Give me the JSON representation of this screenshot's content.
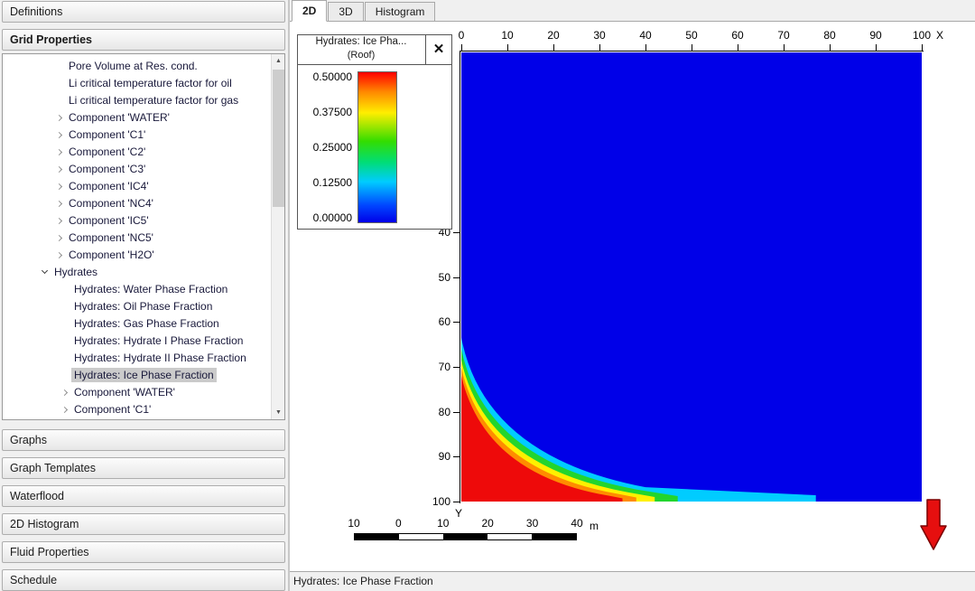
{
  "window": {
    "status_bar": "Hydrates: Ice Phase Fraction"
  },
  "sidebar": {
    "top_sections": [
      {
        "label": "Definitions",
        "bold": false
      },
      {
        "label": "Grid Properties",
        "bold": true
      }
    ],
    "tree_items": [
      {
        "label": "Pore Volume at Res. cond.",
        "level": 1,
        "arrow": "none",
        "selected": false
      },
      {
        "label": "Li critical temperature factor for oil",
        "level": 1,
        "arrow": "none",
        "selected": false
      },
      {
        "label": "Li critical temperature factor for gas",
        "level": 1,
        "arrow": "none",
        "selected": false
      },
      {
        "label": "Component 'WATER'",
        "level": 1,
        "arrow": "right",
        "selected": false
      },
      {
        "label": "Component 'C1'",
        "level": 1,
        "arrow": "right",
        "selected": false
      },
      {
        "label": "Component 'C2'",
        "level": 1,
        "arrow": "right",
        "selected": false
      },
      {
        "label": "Component 'C3'",
        "level": 1,
        "arrow": "right",
        "selected": false
      },
      {
        "label": "Component 'IC4'",
        "level": 1,
        "arrow": "right",
        "selected": false
      },
      {
        "label": "Component 'NC4'",
        "level": 1,
        "arrow": "right",
        "selected": false
      },
      {
        "label": "Component 'IC5'",
        "level": 1,
        "arrow": "right",
        "selected": false
      },
      {
        "label": "Component 'NC5'",
        "level": 1,
        "arrow": "right",
        "selected": false
      },
      {
        "label": "Component 'H2O'",
        "level": 1,
        "arrow": "right",
        "selected": false
      },
      {
        "label": "Hydrates",
        "level": 0,
        "arrow": "down",
        "selected": false
      },
      {
        "label": "Hydrates: Water Phase Fraction",
        "level": 2,
        "arrow": "none",
        "selected": false
      },
      {
        "label": "Hydrates: Oil Phase Fraction",
        "level": 2,
        "arrow": "none",
        "selected": false
      },
      {
        "label": "Hydrates: Gas Phase Fraction",
        "level": 2,
        "arrow": "none",
        "selected": false
      },
      {
        "label": "Hydrates: Hydrate I Phase Fraction",
        "level": 2,
        "arrow": "none",
        "selected": false
      },
      {
        "label": "Hydrates: Hydrate II Phase Fraction",
        "level": 2,
        "arrow": "none",
        "selected": false
      },
      {
        "label": "Hydrates: Ice Phase Fraction",
        "level": 2,
        "arrow": "none",
        "selected": true
      },
      {
        "label": "Component 'WATER'",
        "level": 2,
        "arrow": "right",
        "selected": false
      },
      {
        "label": "Component 'C1'",
        "level": 2,
        "arrow": "right",
        "selected": false
      }
    ],
    "bottom_sections": [
      {
        "label": "Graphs"
      },
      {
        "label": "Graph Templates"
      },
      {
        "label": "Waterflood"
      },
      {
        "label": "2D Histogram"
      },
      {
        "label": "Fluid Properties"
      },
      {
        "label": "Schedule"
      }
    ]
  },
  "tabs": [
    {
      "label": "2D",
      "active": true
    },
    {
      "label": "3D",
      "active": false
    },
    {
      "label": "Histogram",
      "active": false
    }
  ],
  "legend": {
    "title": "Hydrates: Ice Pha...",
    "subtitle": "(Roof)",
    "close_icon": "✕",
    "tick_labels": [
      "0.50000",
      "0.37500",
      "0.25000",
      "0.12500",
      "0.00000"
    ],
    "gradient_stops": [
      {
        "color": "#ff0000",
        "pos": 0
      },
      {
        "color": "#ff8800",
        "pos": 13
      },
      {
        "color": "#ffee00",
        "pos": 27
      },
      {
        "color": "#33dd00",
        "pos": 46
      },
      {
        "color": "#00dd77",
        "pos": 60
      },
      {
        "color": "#00ccff",
        "pos": 73
      },
      {
        "color": "#0044ff",
        "pos": 89
      },
      {
        "color": "#0000e8",
        "pos": 100
      }
    ]
  },
  "plot": {
    "x_axis_label": "X",
    "y_axis_label": "Y",
    "x_tick_labels": [
      "0",
      "10",
      "20",
      "30",
      "40",
      "50",
      "60",
      "70",
      "80",
      "90",
      "100"
    ],
    "y_tick_labels": [
      "40",
      "50",
      "60",
      "70",
      "80",
      "90",
      "100"
    ],
    "scale_bar": {
      "labels": [
        "10",
        "0",
        "10",
        "20",
        "30",
        "40"
      ],
      "unit": "m"
    }
  },
  "chart_data": {
    "type": "heatmap",
    "title": "Hydrates: Ice Phase Fraction (Roof)",
    "x_range": [
      0,
      100
    ],
    "y_range": [
      0,
      100
    ],
    "value_range": [
      0.0,
      0.5
    ],
    "colorbar_ticks": [
      0.5,
      0.375,
      0.25,
      0.125,
      0.0
    ],
    "background_value": 0.0,
    "background_color": "#0000e8",
    "description": "Ice phase fraction is ~0.5 (red) in the lower-left corner of the grid (left edge below y≈72 and a strip along the bottom edge out to x≈34), with a narrow rainbow transition band (orange-yellow-green-cyan) to 0.0 (blue) everywhere else; a thin cyan fringe runs along the bottom edge out to x≈77.",
    "contours": [
      {
        "level": 0.06,
        "color": "#00ccff",
        "y_left": 63.5,
        "ctrl": [
          5,
          90
        ],
        "knee": [
          40,
          96.8
        ],
        "tail_x": 77,
        "tail_y": 98.6
      },
      {
        "level": 0.15,
        "color": "#22d52e",
        "y_left": 66.0,
        "ctrl": [
          5,
          91
        ],
        "knee": [
          38,
          97.3
        ],
        "tail_x": 47,
        "tail_y": 98.8
      },
      {
        "level": 0.27,
        "color": "#fff000",
        "y_left": 68.5,
        "ctrl": [
          5,
          92
        ],
        "knee": [
          36,
          97.9
        ],
        "tail_x": 42,
        "tail_y": 99.0
      },
      {
        "level": 0.38,
        "color": "#ff8c00",
        "y_left": 70.2,
        "ctrl": [
          5,
          93
        ],
        "knee": [
          34,
          98.3
        ],
        "tail_x": 38,
        "tail_y": 99.1
      },
      {
        "level": 0.5,
        "color": "#ee0a0a",
        "y_left": 72.0,
        "ctrl": [
          5,
          94
        ],
        "knee": [
          32,
          98.7
        ],
        "tail_x": 35,
        "tail_y": 99.3
      }
    ]
  }
}
